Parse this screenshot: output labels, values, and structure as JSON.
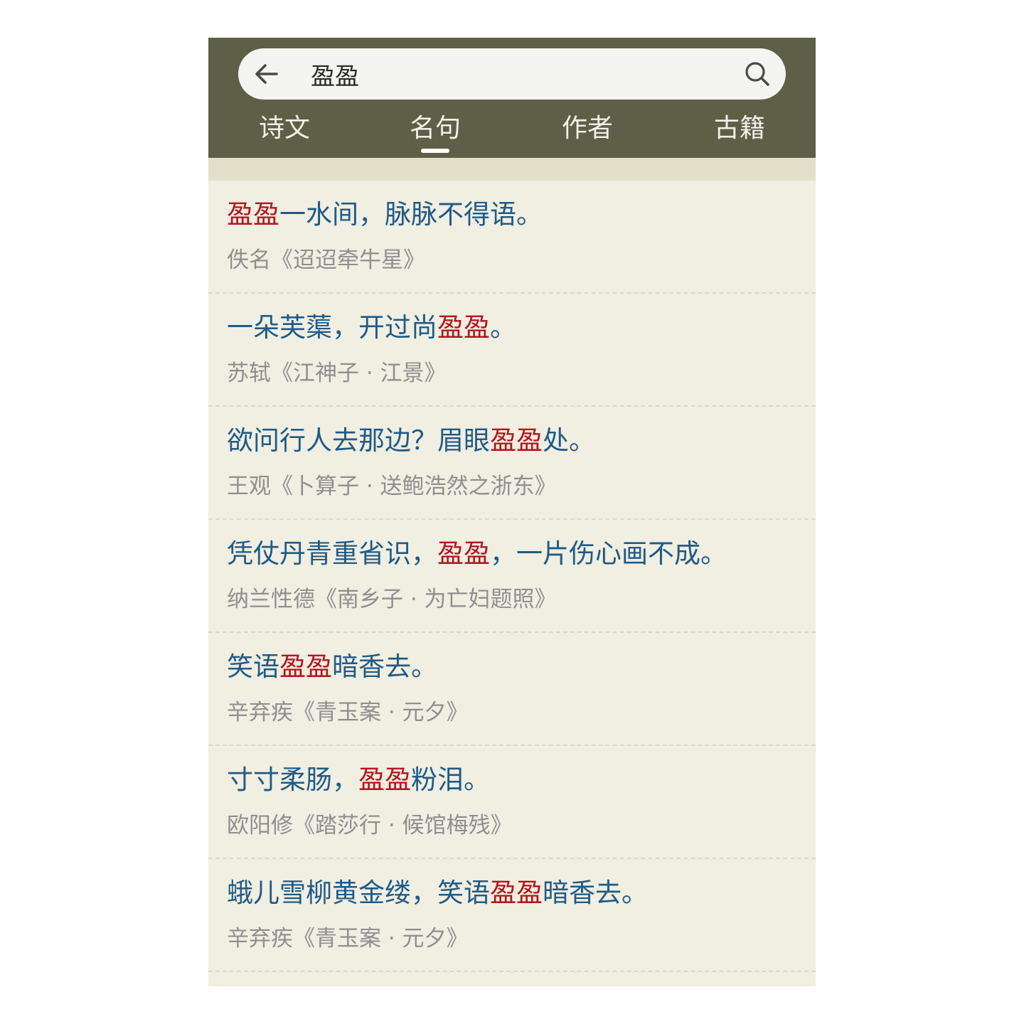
{
  "search": {
    "query": "盈盈",
    "back_icon": "arrow-left-icon",
    "search_icon": "search-icon"
  },
  "tabs": [
    {
      "label": "诗文",
      "active": false
    },
    {
      "label": "名句",
      "active": true
    },
    {
      "label": "作者",
      "active": false
    },
    {
      "label": "古籍",
      "active": false
    }
  ],
  "results": [
    {
      "pre": "",
      "hl": "盈盈",
      "post": "一水间，脉脉不得语。",
      "source": "佚名《迢迢牵牛星》"
    },
    {
      "pre": "一朵芙蕖，开过尚",
      "hl": "盈盈",
      "post": "。",
      "source": "苏轼《江神子 · 江景》"
    },
    {
      "pre": "欲问行人去那边？眉眼",
      "hl": "盈盈",
      "post": "处。",
      "source": "王观《卜算子 · 送鲍浩然之浙东》"
    },
    {
      "pre": "凭仗丹青重省识，",
      "hl": "盈盈",
      "post": "，一片伤心画不成。",
      "source": "纳兰性德《南乡子 · 为亡妇题照》"
    },
    {
      "pre": "笑语",
      "hl": "盈盈",
      "post": "暗香去。",
      "source": "辛弃疾《青玉案 · 元夕》"
    },
    {
      "pre": "寸寸柔肠，",
      "hl": "盈盈",
      "post": "粉泪。",
      "source": "欧阳修《踏莎行 · 候馆梅残》"
    },
    {
      "pre": "蛾儿雪柳黄金缕，笑语",
      "hl": "盈盈",
      "post": "暗香去。",
      "source": "辛弃疾《青玉案 · 元夕》"
    }
  ],
  "colors": {
    "header": "#5e5f47",
    "background": "#f1eee2",
    "quote": "#1f5b87",
    "highlight": "#b4141c",
    "source": "#8f8f8f"
  }
}
